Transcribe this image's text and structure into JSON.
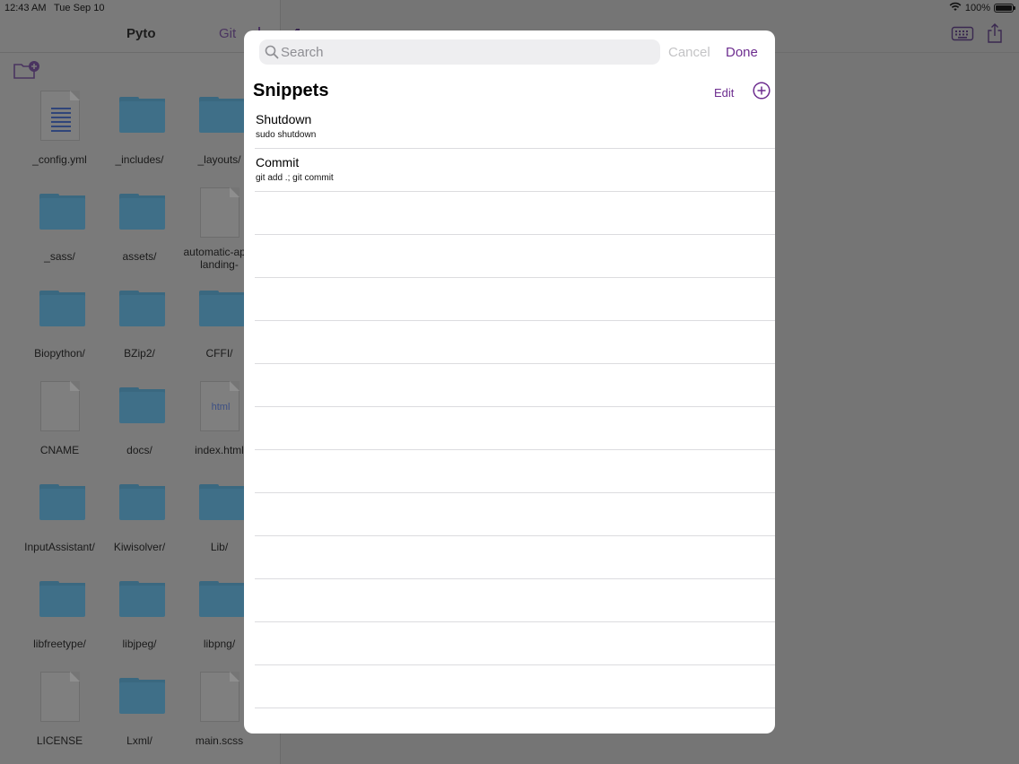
{
  "status_bar": {
    "time": "12:43 AM",
    "date": "Tue Sep 10",
    "battery": "100%",
    "battery_level": 1.0
  },
  "sidebar": {
    "title": "Pyto",
    "git_label": "Git",
    "files": [
      {
        "name": "_config.yml",
        "kind": "text-doc"
      },
      {
        "name": "_includes/",
        "kind": "folder"
      },
      {
        "name": "_layouts/",
        "kind": "folder"
      },
      {
        "name": "_sass/",
        "kind": "folder"
      },
      {
        "name": "assets/",
        "kind": "folder"
      },
      {
        "name": "automatic-app-landing-",
        "kind": "doc"
      },
      {
        "name": "Biopython/",
        "kind": "folder"
      },
      {
        "name": "BZip2/",
        "kind": "folder"
      },
      {
        "name": "CFFI/",
        "kind": "folder"
      },
      {
        "name": "CNAME",
        "kind": "doc"
      },
      {
        "name": "docs/",
        "kind": "folder"
      },
      {
        "name": "index.html",
        "kind": "html-doc",
        "badge": "html"
      },
      {
        "name": "InputAssistant/",
        "kind": "folder"
      },
      {
        "name": "Kiwisolver/",
        "kind": "folder"
      },
      {
        "name": "Lib/",
        "kind": "folder"
      },
      {
        "name": "libfreetype/",
        "kind": "folder"
      },
      {
        "name": "libjpeg/",
        "kind": "folder"
      },
      {
        "name": "libpng/",
        "kind": "folder"
      },
      {
        "name": "LICENSE",
        "kind": "doc"
      },
      {
        "name": "Lxml/",
        "kind": "folder"
      },
      {
        "name": "main.scss",
        "kind": "doc"
      }
    ]
  },
  "toolbar": {
    "icons": [
      "keyboard-icon",
      "share-icon"
    ]
  },
  "modal": {
    "search": {
      "placeholder": "Search",
      "value": ""
    },
    "cancel_label": "Cancel",
    "done_label": "Done",
    "title": "Snippets",
    "edit_label": "Edit",
    "snippets": [
      {
        "name": "Shutdown",
        "command": "sudo shutdown"
      },
      {
        "name": "Commit",
        "command": "git add .; git commit"
      }
    ]
  },
  "colors": {
    "accent": "#6d2d8f",
    "overlay_bg": "#757575",
    "folder": "#3f6f88"
  }
}
